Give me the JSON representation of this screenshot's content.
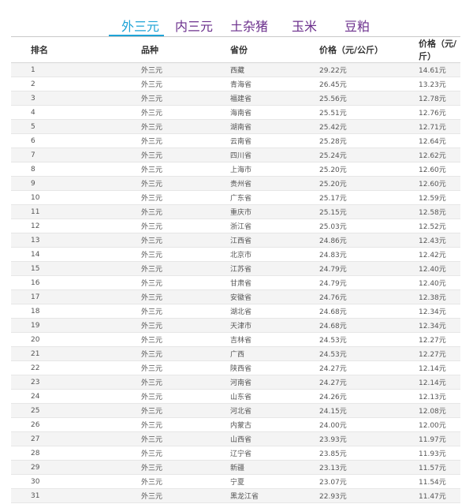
{
  "tabs": [
    {
      "label": "外三元",
      "active": true
    },
    {
      "label": "内三元",
      "active": false
    },
    {
      "label": "土杂猪",
      "active": false
    },
    {
      "label": "玉米",
      "active": false
    },
    {
      "label": "豆粕",
      "active": false
    }
  ],
  "table": {
    "headers": [
      "排名",
      "品种",
      "省份",
      "价格（元/公斤）",
      "价格（元/斤）"
    ],
    "rows": [
      [
        "1",
        "外三元",
        "西藏",
        "29.22元",
        "14.61元"
      ],
      [
        "2",
        "外三元",
        "青海省",
        "26.45元",
        "13.23元"
      ],
      [
        "3",
        "外三元",
        "福建省",
        "25.56元",
        "12.78元"
      ],
      [
        "4",
        "外三元",
        "海南省",
        "25.51元",
        "12.76元"
      ],
      [
        "5",
        "外三元",
        "湖南省",
        "25.42元",
        "12.71元"
      ],
      [
        "6",
        "外三元",
        "云南省",
        "25.28元",
        "12.64元"
      ],
      [
        "7",
        "外三元",
        "四川省",
        "25.24元",
        "12.62元"
      ],
      [
        "8",
        "外三元",
        "上海市",
        "25.20元",
        "12.60元"
      ],
      [
        "9",
        "外三元",
        "贵州省",
        "25.20元",
        "12.60元"
      ],
      [
        "10",
        "外三元",
        "广东省",
        "25.17元",
        "12.59元"
      ],
      [
        "11",
        "外三元",
        "重庆市",
        "25.15元",
        "12.58元"
      ],
      [
        "12",
        "外三元",
        "浙江省",
        "25.03元",
        "12.52元"
      ],
      [
        "13",
        "外三元",
        "江西省",
        "24.86元",
        "12.43元"
      ],
      [
        "14",
        "外三元",
        "北京市",
        "24.83元",
        "12.42元"
      ],
      [
        "15",
        "外三元",
        "江苏省",
        "24.79元",
        "12.40元"
      ],
      [
        "16",
        "外三元",
        "甘肃省",
        "24.79元",
        "12.40元"
      ],
      [
        "17",
        "外三元",
        "安徽省",
        "24.76元",
        "12.38元"
      ],
      [
        "18",
        "外三元",
        "湖北省",
        "24.68元",
        "12.34元"
      ],
      [
        "19",
        "外三元",
        "天津市",
        "24.68元",
        "12.34元"
      ],
      [
        "20",
        "外三元",
        "吉林省",
        "24.53元",
        "12.27元"
      ],
      [
        "21",
        "外三元",
        "广西",
        "24.53元",
        "12.27元"
      ],
      [
        "22",
        "外三元",
        "陕西省",
        "24.27元",
        "12.14元"
      ],
      [
        "23",
        "外三元",
        "河南省",
        "24.27元",
        "12.14元"
      ],
      [
        "24",
        "外三元",
        "山东省",
        "24.26元",
        "12.13元"
      ],
      [
        "25",
        "外三元",
        "河北省",
        "24.15元",
        "12.08元"
      ],
      [
        "26",
        "外三元",
        "内蒙古",
        "24.00元",
        "12.00元"
      ],
      [
        "27",
        "外三元",
        "山西省",
        "23.93元",
        "11.97元"
      ],
      [
        "28",
        "外三元",
        "辽宁省",
        "23.85元",
        "11.93元"
      ],
      [
        "29",
        "外三元",
        "新疆",
        "23.13元",
        "11.57元"
      ],
      [
        "30",
        "外三元",
        "宁夏",
        "23.07元",
        "11.54元"
      ],
      [
        "31",
        "外三元",
        "黑龙江省",
        "22.93元",
        "11.47元"
      ]
    ]
  },
  "colors": {
    "active_tab": "#1ea3d6",
    "inactive_tab": "#6b2f8c",
    "row_stripe": "#f4f4f4"
  }
}
